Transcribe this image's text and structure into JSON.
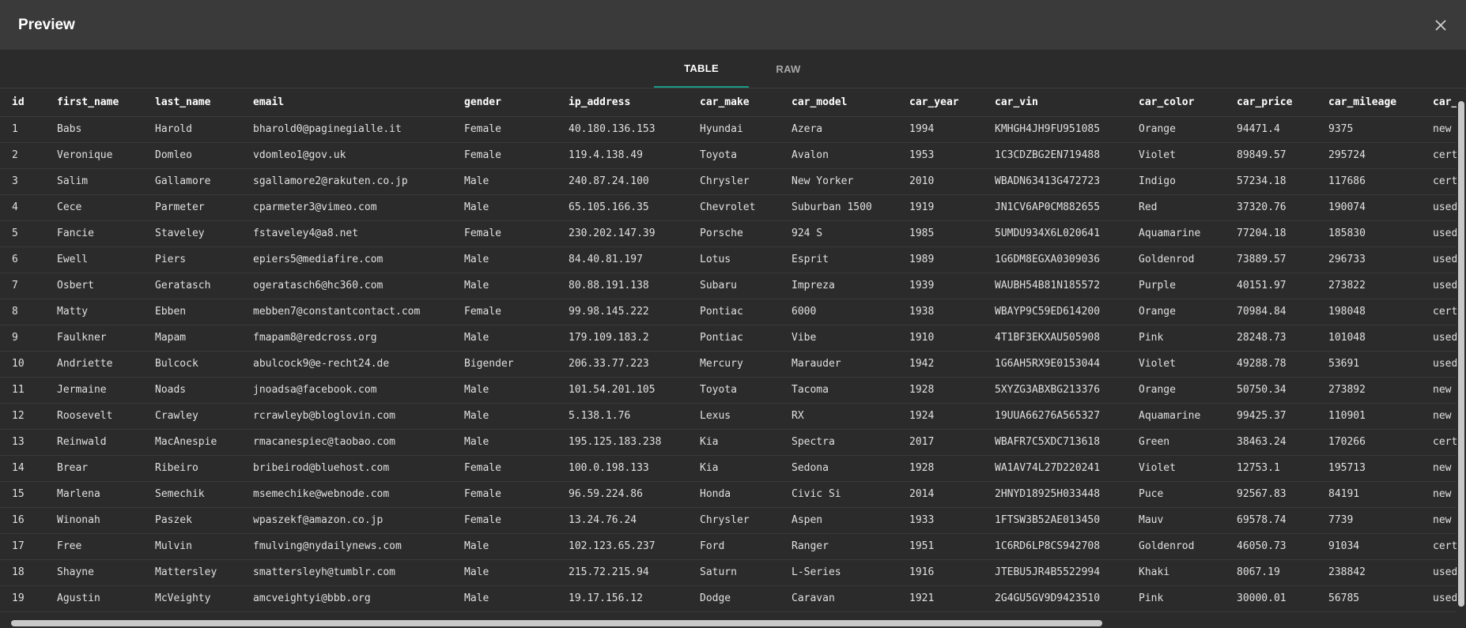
{
  "window": {
    "title": "Preview",
    "close_icon": "close-icon"
  },
  "tabs": [
    {
      "label": "TABLE",
      "active": true
    },
    {
      "label": "RAW",
      "active": false
    }
  ],
  "accent_color": "#1a9b87",
  "table": {
    "columns": [
      "id",
      "first_name",
      "last_name",
      "email",
      "gender",
      "ip_address",
      "car_make",
      "car_model",
      "car_year",
      "car_vin",
      "car_color",
      "car_price",
      "car_mileage",
      "car_"
    ],
    "rows": [
      [
        "1",
        "Babs",
        "Harold",
        "bharold0@paginegialle.it",
        "Female",
        "40.180.136.153",
        "Hyundai",
        "Azera",
        "1994",
        "KMHGH4JH9FU951085",
        "Orange",
        "94471.4",
        "9375",
        "new"
      ],
      [
        "2",
        "Veronique",
        "Domleo",
        "vdomleo1@gov.uk",
        "Female",
        "119.4.138.49",
        "Toyota",
        "Avalon",
        "1953",
        "1C3CDZBG2EN719488",
        "Violet",
        "89849.57",
        "295724",
        "cert"
      ],
      [
        "3",
        "Salim",
        "Gallamore",
        "sgallamore2@rakuten.co.jp",
        "Male",
        "240.87.24.100",
        "Chrysler",
        "New Yorker",
        "2010",
        "WBADN63413G472723",
        "Indigo",
        "57234.18",
        "117686",
        "cert"
      ],
      [
        "4",
        "Cece",
        "Parmeter",
        "cparmeter3@vimeo.com",
        "Male",
        "65.105.166.35",
        "Chevrolet",
        "Suburban 1500",
        "1919",
        "JN1CV6AP0CM882655",
        "Red",
        "37320.76",
        "190074",
        "used"
      ],
      [
        "5",
        "Fancie",
        "Staveley",
        "fstaveley4@a8.net",
        "Female",
        "230.202.147.39",
        "Porsche",
        "924 S",
        "1985",
        "5UMDU934X6L020641",
        "Aquamarine",
        "77204.18",
        "185830",
        "used"
      ],
      [
        "6",
        "Ewell",
        "Piers",
        "epiers5@mediafire.com",
        "Male",
        "84.40.81.197",
        "Lotus",
        "Esprit",
        "1989",
        "1G6DM8EGXA0309036",
        "Goldenrod",
        "73889.57",
        "296733",
        "used"
      ],
      [
        "7",
        "Osbert",
        "Geratasch",
        "ogeratasch6@hc360.com",
        "Male",
        "80.88.191.138",
        "Subaru",
        "Impreza",
        "1939",
        "WAUBH54B81N185572",
        "Purple",
        "40151.97",
        "273822",
        "used"
      ],
      [
        "8",
        "Matty",
        "Ebben",
        "mebben7@constantcontact.com",
        "Female",
        "99.98.145.222",
        "Pontiac",
        "6000",
        "1938",
        "WBAYP9C59ED614200",
        "Orange",
        "70984.84",
        "198048",
        "cert"
      ],
      [
        "9",
        "Faulkner",
        "Mapam",
        "fmapam8@redcross.org",
        "Male",
        "179.109.183.2",
        "Pontiac",
        "Vibe",
        "1910",
        "4T1BF3EKXAU505908",
        "Pink",
        "28248.73",
        "101048",
        "used"
      ],
      [
        "10",
        "Andriette",
        "Bulcock",
        "abulcock9@e-recht24.de",
        "Bigender",
        "206.33.77.223",
        "Mercury",
        "Marauder",
        "1942",
        "1G6AH5RX9E0153044",
        "Violet",
        "49288.78",
        "53691",
        "used"
      ],
      [
        "11",
        "Jermaine",
        "Noads",
        "jnoadsa@facebook.com",
        "Male",
        "101.54.201.105",
        "Toyota",
        "Tacoma",
        "1928",
        "5XYZG3ABXBG213376",
        "Orange",
        "50750.34",
        "273892",
        "new"
      ],
      [
        "12",
        "Roosevelt",
        "Crawley",
        "rcrawleyb@bloglovin.com",
        "Male",
        "5.138.1.76",
        "Lexus",
        "RX",
        "1924",
        "19UUA66276A565327",
        "Aquamarine",
        "99425.37",
        "110901",
        "new"
      ],
      [
        "13",
        "Reinwald",
        "MacAnespie",
        "rmacanespiec@taobao.com",
        "Male",
        "195.125.183.238",
        "Kia",
        "Spectra",
        "2017",
        "WBAFR7C5XDC713618",
        "Green",
        "38463.24",
        "170266",
        "cert"
      ],
      [
        "14",
        "Brear",
        "Ribeiro",
        "bribeirod@bluehost.com",
        "Female",
        "100.0.198.133",
        "Kia",
        "Sedona",
        "1928",
        "WA1AV74L27D220241",
        "Violet",
        "12753.1",
        "195713",
        "new"
      ],
      [
        "15",
        "Marlena",
        "Semechik",
        "msemechike@webnode.com",
        "Female",
        "96.59.224.86",
        "Honda",
        "Civic Si",
        "2014",
        "2HNYD18925H033448",
        "Puce",
        "92567.83",
        "84191",
        "new"
      ],
      [
        "16",
        "Winonah",
        "Paszek",
        "wpaszekf@amazon.co.jp",
        "Female",
        "13.24.76.24",
        "Chrysler",
        "Aspen",
        "1933",
        "1FTSW3B52AE013450",
        "Mauv",
        "69578.74",
        "7739",
        "new"
      ],
      [
        "17",
        "Free",
        "Mulvin",
        "fmulving@nydailynews.com",
        "Male",
        "102.123.65.237",
        "Ford",
        "Ranger",
        "1951",
        "1C6RD6LP8CS942708",
        "Goldenrod",
        "46050.73",
        "91034",
        "cert"
      ],
      [
        "18",
        "Shayne",
        "Mattersley",
        "smattersleyh@tumblr.com",
        "Male",
        "215.72.215.94",
        "Saturn",
        "L-Series",
        "1916",
        "JTEBU5JR4B5522994",
        "Khaki",
        "8067.19",
        "238842",
        "used"
      ],
      [
        "19",
        "Agustin",
        "McVeighty",
        "amcveightyi@bbb.org",
        "Male",
        "19.17.156.12",
        "Dodge",
        "Caravan",
        "1921",
        "2G4GU5GV9D9423510",
        "Pink",
        "30000.01",
        "56785",
        "used"
      ]
    ]
  }
}
